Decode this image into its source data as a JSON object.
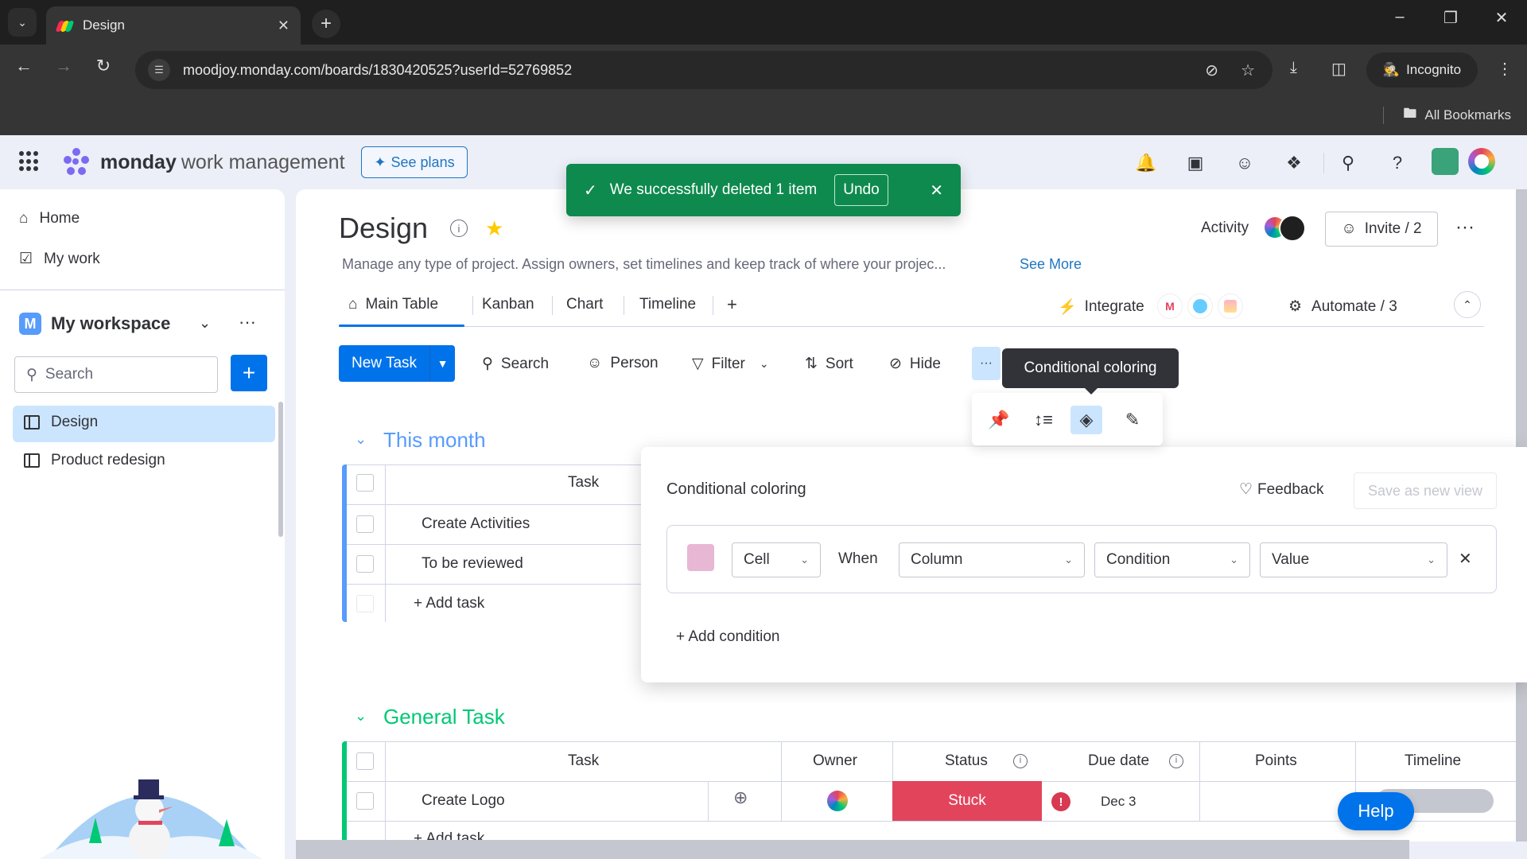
{
  "browser": {
    "tab_title": "Design",
    "url": "moodjoy.monday.com/boards/1830420525?userId=52769852",
    "incognito_label": "Incognito",
    "bookmarks_label": "All Bookmarks",
    "icons": [
      "tab-list-icon",
      "close-tab-icon",
      "new-tab-icon",
      "back-icon",
      "forward-icon",
      "reload-icon",
      "site-settings-icon",
      "eye-off-icon",
      "bookmark-star-icon",
      "download-icon",
      "side-panel-icon",
      "incognito-icon",
      "kebab-menu-icon",
      "minimize-icon",
      "restore-icon",
      "close-window-icon",
      "folder-icon"
    ]
  },
  "app": {
    "brand_bold": "monday",
    "brand_sub": "work management",
    "see_plans": "See plans",
    "header_icons": [
      "bell-icon",
      "inbox-icon",
      "invite-members-icon",
      "apps-puzzle-icon",
      "search-icon",
      "help-icon"
    ]
  },
  "toast": {
    "message": "We successfully deleted 1 item",
    "undo": "Undo",
    "accent": "#0e8a4f"
  },
  "sidebar": {
    "home": "Home",
    "my_work": "My work",
    "workspace_initial": "M",
    "workspace_name": "My workspace",
    "search_placeholder": "Search",
    "boards": [
      {
        "label": "Design",
        "active": true
      },
      {
        "label": "Product redesign",
        "active": false
      }
    ]
  },
  "board": {
    "title": "Design",
    "description": "Manage any type of project. Assign owners, set timelines and keep track of where your projec...",
    "see_more": "See More",
    "activity": "Activity",
    "invite": "Invite / 2",
    "views": [
      "Main Table",
      "Kanban",
      "Chart",
      "Timeline"
    ],
    "add_view": "+",
    "integrate": "Integrate",
    "automate": "Automate / 3"
  },
  "toolbar": {
    "new_task": "New Task",
    "search": "Search",
    "person": "Person",
    "filter": "Filter",
    "sort": "Sort",
    "hide": "Hide",
    "more": "···",
    "tooltip": "Conditional coloring",
    "icon_bar": [
      "pin-icon",
      "row-height-icon",
      "paint-bucket-icon",
      "edit-pencil-icon"
    ]
  },
  "groups": [
    {
      "title": "This month",
      "color": "#579bfc",
      "columns": [
        "Task"
      ],
      "rows": [
        {
          "task": "Create Activities"
        },
        {
          "task": "To be reviewed"
        }
      ],
      "add_task": "+ Add task"
    },
    {
      "title": "General Task",
      "color": "#00c875",
      "columns": [
        "Task",
        "Owner",
        "Status",
        "Due date",
        "Points",
        "Timeline"
      ],
      "rows": [
        {
          "task": "Create Logo",
          "owner": "",
          "status": "Stuck",
          "status_color": "#e2445c",
          "due_date": "Dec 3",
          "points": "",
          "timeline": ""
        }
      ],
      "add_task": "+ Add task"
    }
  ],
  "conditional_coloring": {
    "title": "Conditional coloring",
    "feedback": "Feedback",
    "save_view": "Save as new view",
    "rule": {
      "color": "#e8b7d4",
      "target": "Cell",
      "when": "When",
      "column_placeholder": "Column",
      "condition_placeholder": "Condition",
      "value_placeholder": "Value"
    },
    "add_condition": "+ Add condition"
  },
  "help": "Help"
}
